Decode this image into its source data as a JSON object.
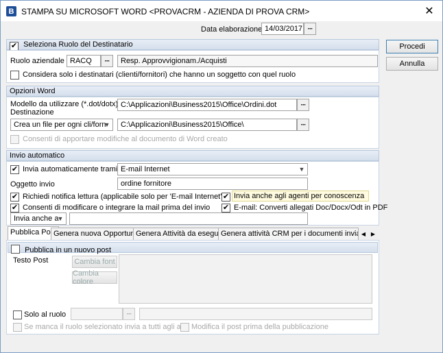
{
  "window": {
    "icon_letter": "B",
    "title": "STAMPA SU MICROSOFT WORD <PROVACRM - AZIENDA DI PROVA CRM>"
  },
  "header": {
    "date_label": "Data elaborazione",
    "date_value": "14/03/2017"
  },
  "buttons": {
    "procedi": "Procedi",
    "annulla": "Annulla",
    "dots": "···"
  },
  "destinatario": {
    "header": "Seleziona Ruolo del Destinatario",
    "header_checked": true,
    "ruolo_label": "Ruolo aziendale",
    "ruolo_code": "RACQ",
    "ruolo_desc": "Resp. Approvvigionam./Acquisti",
    "solo_label": "Considera solo i destinatari (clienti/fornitori) che hanno un soggetto con quel ruolo"
  },
  "opzioni_word": {
    "header": "Opzioni Word",
    "modello_label": "Modello da utilizzare (*.dot/dotx)",
    "modello_value": "C:\\Applicazioni\\Business2015\\Office\\Ordini.dot",
    "destinazione_label": "Destinazione",
    "destinazione_select": "Crea un file per ogni cli/forn",
    "destinazione_value": "C:\\Applicazioni\\Business2015\\Office\\",
    "consenti_label": "Consenti di apportare modifiche al documento di Word creato"
  },
  "invio": {
    "header": "Invio automatico",
    "invia_label": "Invia automaticamente tramite",
    "invia_value": "E-mail Internet",
    "oggetto_label": "Oggetto invio",
    "oggetto_value": "ordine fornitore",
    "notifica_label": "Richiedi notifica lettura (applicabile solo per 'E-mail Internet')",
    "agenti_label": "Invia anche agli agenti per conoscenza",
    "modifica_label": "Consenti di modificare o integrare la mail prima del invio",
    "converti_label": "E-mail: Converti allegati Doc/Docx/Odt in PDF",
    "invia_anche_select": "Invia anche a",
    "invia_anche_value": ""
  },
  "tabs": [
    {
      "label": "Pubblica Post"
    },
    {
      "label": "Genera nuova Opportunità"
    },
    {
      "label": "Genera Attività da eseguire"
    },
    {
      "label": "Genera attività CRM per i documenti inviati auto"
    }
  ],
  "post": {
    "header": "Pubblica in un nuovo post",
    "testo_label": "Testo Post",
    "cambia_font": "Cambia font",
    "cambia_colore": "Cambia colore",
    "solo_ruolo_label": "Solo al ruolo",
    "se_manca_label": "Se manca il ruolo selezionato invia a tutti agli altri",
    "modifica_post_label": "Modifica il post prima della pubblicazione"
  }
}
